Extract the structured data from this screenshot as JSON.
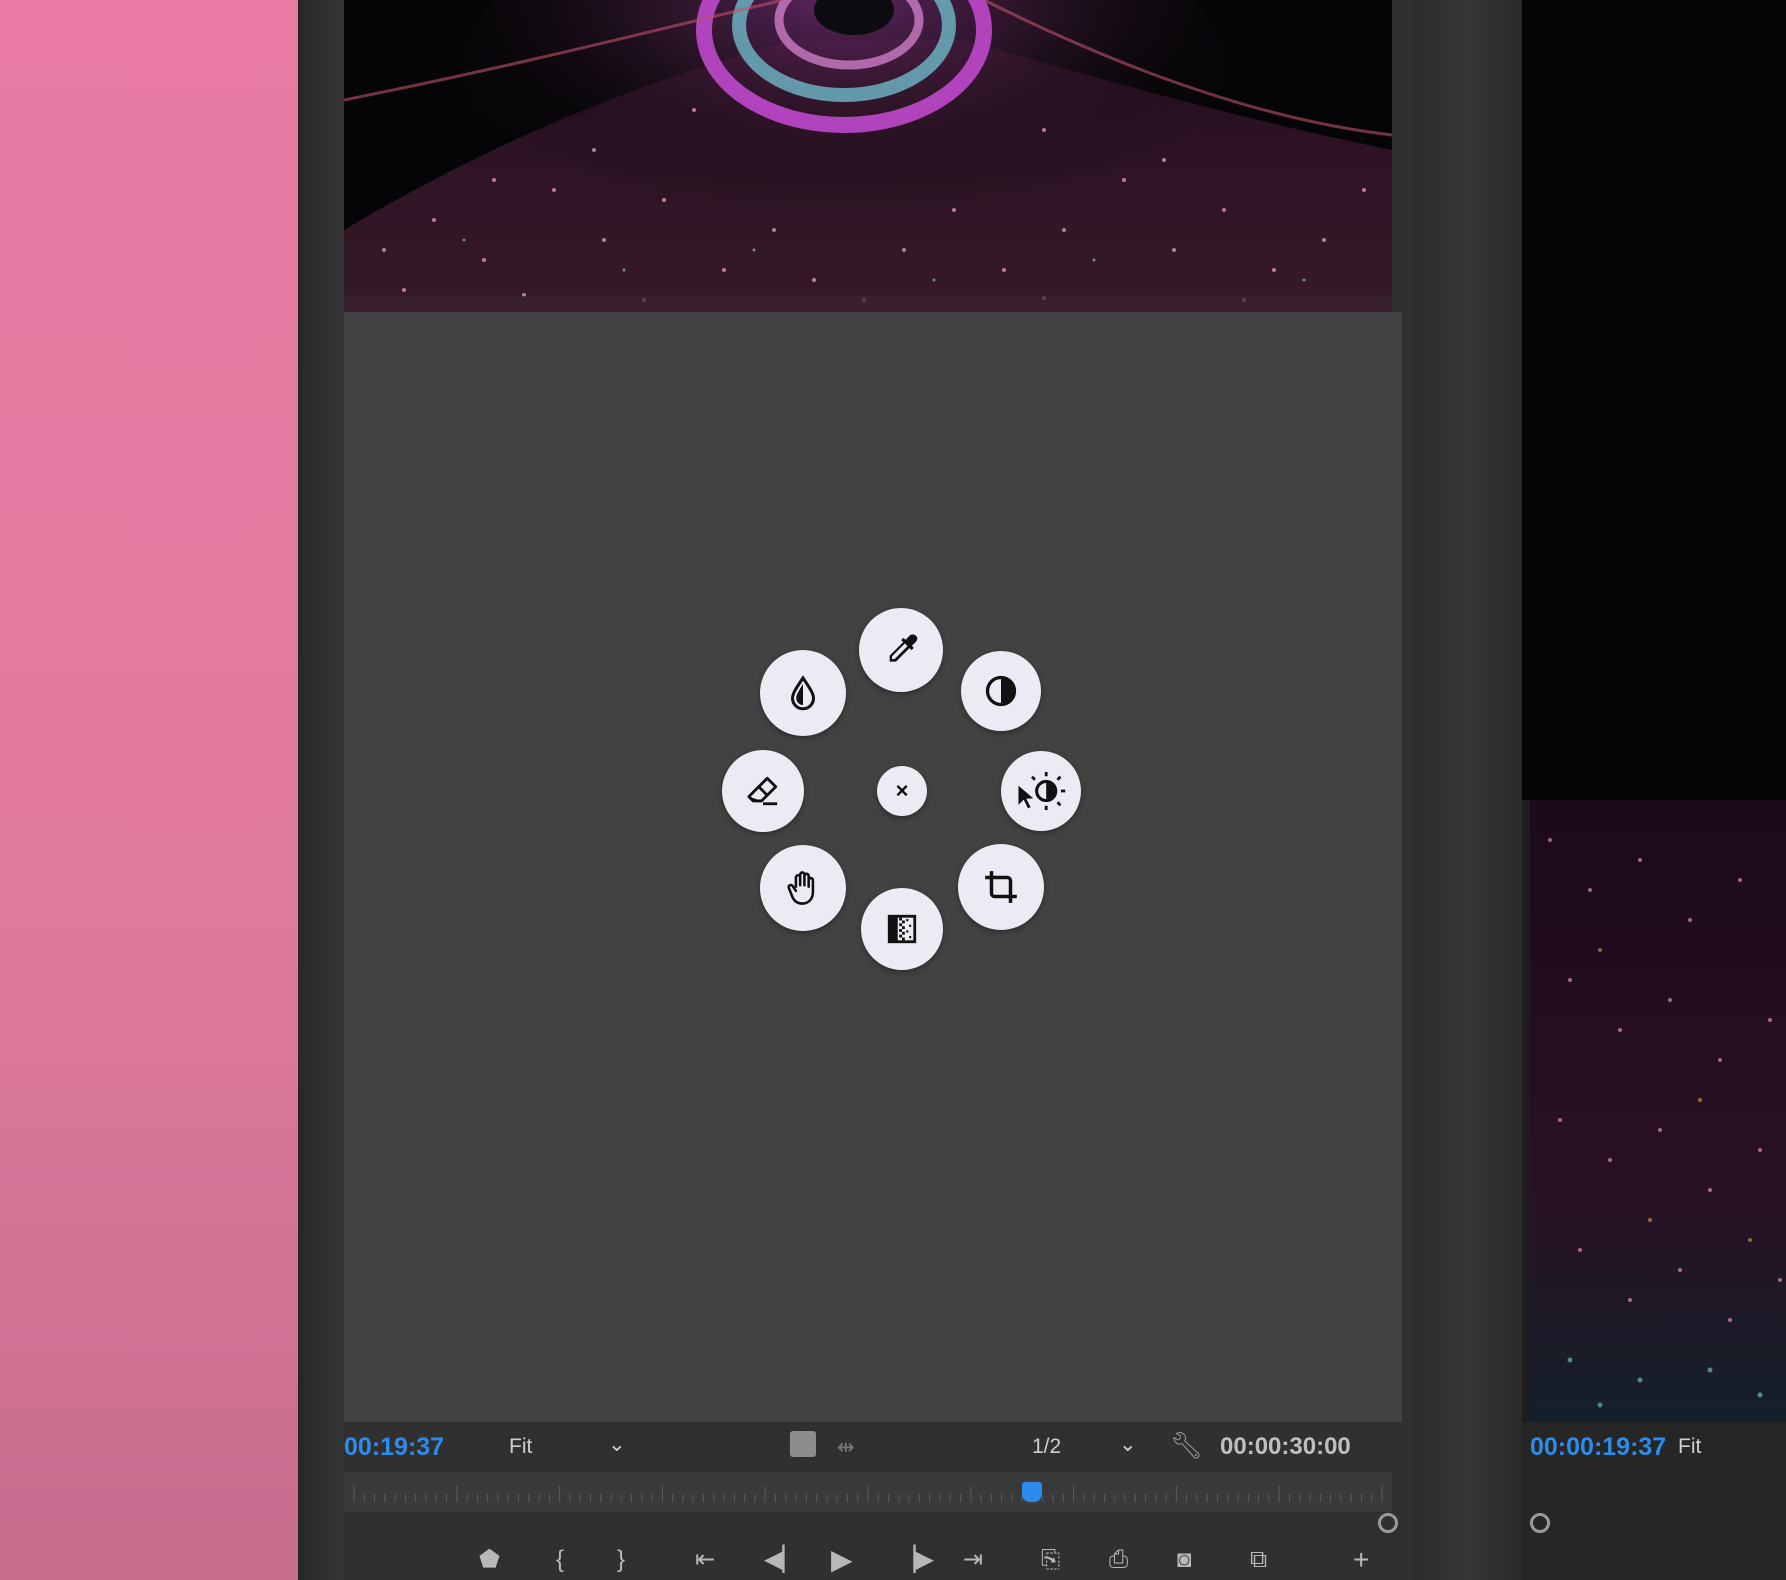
{
  "program_monitor": {
    "timecode": "00:19:37",
    "zoom": "Fit",
    "resolution": "1/2",
    "duration": "00:00:30:00",
    "playhead_position": 0.66
  },
  "radial_menu": {
    "center_label": "×",
    "items": [
      {
        "name": "eyedropper",
        "icon": "eyedropper-icon"
      },
      {
        "name": "contrast",
        "icon": "contrast-icon"
      },
      {
        "name": "brightness",
        "icon": "brightness-contrast-icon"
      },
      {
        "name": "crop",
        "icon": "crop-icon"
      },
      {
        "name": "gradient",
        "icon": "gradient-icon"
      },
      {
        "name": "hand",
        "icon": "hand-icon"
      },
      {
        "name": "eraser",
        "icon": "eraser-icon"
      },
      {
        "name": "color-drop",
        "icon": "drop-icon"
      }
    ]
  },
  "source_monitor": {
    "timecode": "00:00:19:37",
    "zoom": "Fit"
  },
  "colors": {
    "accent": "#2d8ceb",
    "background_pink": "#e87aa3",
    "panel": "#424242"
  }
}
